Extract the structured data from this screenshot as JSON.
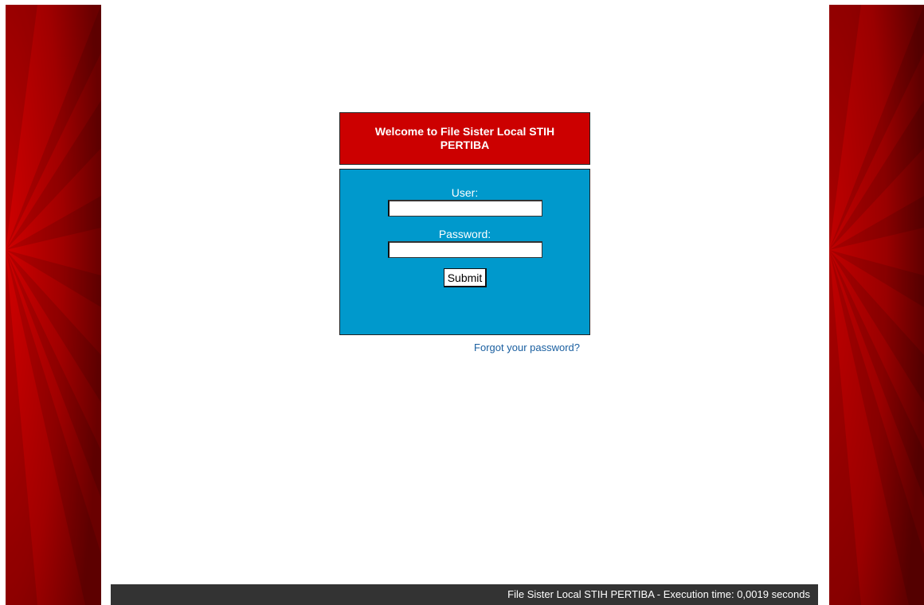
{
  "welcome": {
    "title": "Welcome to File Sister Local STIH PERTIBA"
  },
  "login": {
    "user_label": "User:",
    "user_value": "",
    "password_label": "Password:",
    "password_value": "",
    "submit_label": "Submit",
    "forgot_link": "Forgot your password?"
  },
  "footer": {
    "text": "File Sister Local STIH PERTIBA - Execution time: 0,0019 seconds"
  },
  "colors": {
    "header_red": "#cc0000",
    "login_blue": "#0099cc",
    "footer_dark": "#333333",
    "side_red": "#b00000",
    "link_blue": "#1a5fa0"
  }
}
